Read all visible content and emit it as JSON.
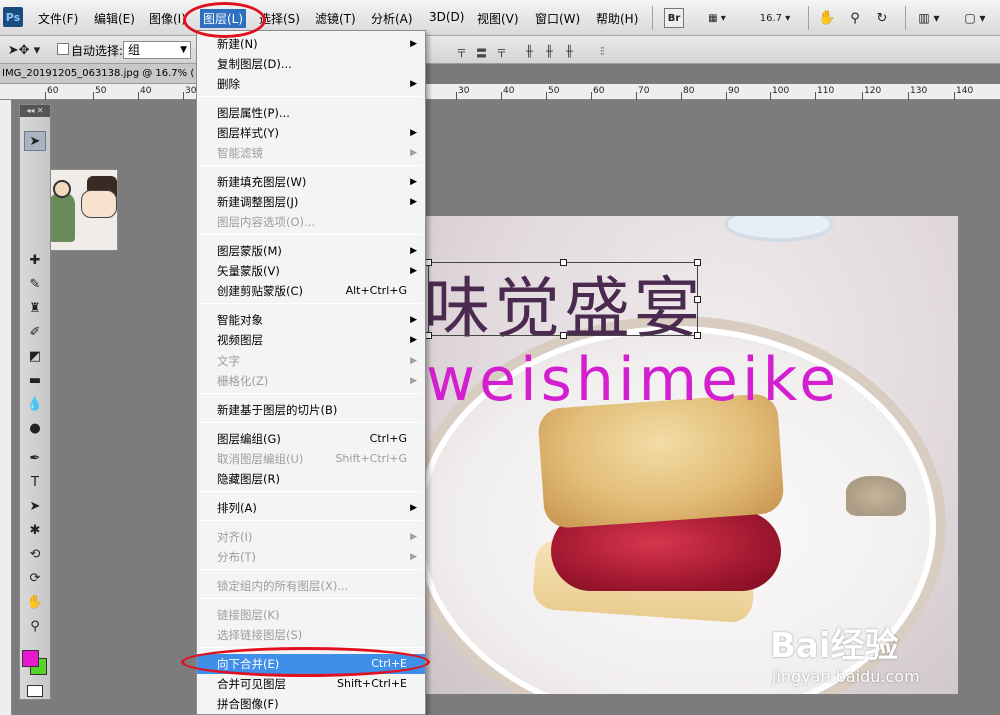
{
  "menubar": {
    "app_logo": "Ps",
    "items": [
      "文件(F)",
      "编辑(E)",
      "图像(I)",
      "图层(L)",
      "选择(S)",
      "滤镜(T)",
      "分析(A)",
      "3D(D)",
      "视图(V)",
      "窗口(W)",
      "帮助(H)"
    ],
    "active_item": "图层(L)",
    "bridge_label": "Br",
    "zoom_value": "16.7"
  },
  "options": {
    "auto_select_label": "自动选择:",
    "auto_select_value": "组",
    "auto_select_checked": false
  },
  "document": {
    "tab_title": "IMG_20191205_063138.jpg @ 16.7% (",
    "ruler_labels": [
      "60",
      "50",
      "40",
      "30",
      "30",
      "40",
      "50",
      "60",
      "70",
      "80",
      "90",
      "100",
      "110",
      "120",
      "130",
      "140"
    ]
  },
  "canvas": {
    "title_text": "味觉盛宴",
    "subtitle_text": "weishimeike"
  },
  "toolbox": {
    "foreground_color": "#e818d1",
    "background_color": "#56d328",
    "tools": [
      "move-icon",
      "marquee-icon",
      "lasso-icon",
      "quick-select-icon",
      "crop-icon",
      "eyedropper-icon",
      "healing-brush-icon",
      "brush-icon",
      "clone-stamp-icon",
      "history-brush-icon",
      "eraser-icon",
      "gradient-icon",
      "blur-icon",
      "dodge-icon",
      "pen-icon",
      "type-icon",
      "path-select-icon",
      "shape-icon",
      "3d-rotate-icon",
      "3d-orbit-icon",
      "hand-icon",
      "zoom-icon"
    ]
  },
  "layer_menu": {
    "items": [
      {
        "label": "新建(N)",
        "submenu": true,
        "disabled": false
      },
      {
        "label": "复制图层(D)...",
        "disabled": false
      },
      {
        "label": "删除",
        "submenu": true,
        "disabled": false
      },
      {
        "label": "图层属性(P)...",
        "disabled": false
      },
      {
        "label": "图层样式(Y)",
        "submenu": true,
        "disabled": false
      },
      {
        "label": "智能滤镜",
        "submenu": true,
        "disabled": true
      },
      {
        "label": "新建填充图层(W)",
        "submenu": true,
        "disabled": false
      },
      {
        "label": "新建调整图层(J)",
        "submenu": true,
        "disabled": false
      },
      {
        "label": "图层内容选项(O)...",
        "disabled": true
      },
      {
        "label": "图层蒙版(M)",
        "submenu": true,
        "disabled": false
      },
      {
        "label": "矢量蒙版(V)",
        "submenu": true,
        "disabled": false
      },
      {
        "label": "创建剪贴蒙版(C)",
        "shortcut": "Alt+Ctrl+G",
        "disabled": false
      },
      {
        "label": "智能对象",
        "submenu": true,
        "disabled": false
      },
      {
        "label": "视频图层",
        "submenu": true,
        "disabled": false
      },
      {
        "label": "文字",
        "submenu": true,
        "disabled": true
      },
      {
        "label": "栅格化(Z)",
        "submenu": true,
        "disabled": true
      },
      {
        "label": "新建基于图层的切片(B)",
        "disabled": false
      },
      {
        "label": "图层编组(G)",
        "shortcut": "Ctrl+G",
        "disabled": false
      },
      {
        "label": "取消图层编组(U)",
        "shortcut": "Shift+Ctrl+G",
        "disabled": true
      },
      {
        "label": "隐藏图层(R)",
        "disabled": false
      },
      {
        "label": "排列(A)",
        "submenu": true,
        "disabled": false
      },
      {
        "label": "对齐(I)",
        "submenu": true,
        "disabled": true
      },
      {
        "label": "分布(T)",
        "submenu": true,
        "disabled": true
      },
      {
        "label": "锁定组内的所有图层(X)...",
        "disabled": true
      },
      {
        "label": "链接图层(K)",
        "disabled": true
      },
      {
        "label": "选择链接图层(S)",
        "disabled": true
      },
      {
        "label": "向下合并(E)",
        "shortcut": "Ctrl+E",
        "disabled": false,
        "highlighted": true
      },
      {
        "label": "合并可见图层",
        "shortcut": "Shift+Ctrl+E",
        "disabled": false
      },
      {
        "label": "拼合图像(F)",
        "disabled": false
      }
    ]
  },
  "watermark": {
    "logo": "Bai经验",
    "url": "jingyan.baidu.com"
  }
}
